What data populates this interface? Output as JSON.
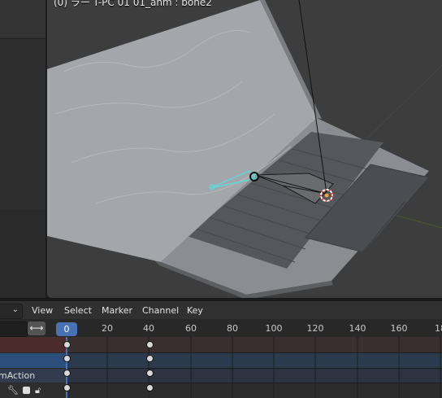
{
  "viewport": {
    "title": "(0) ラー T-PC 01 01_anm : bone2"
  },
  "timeline": {
    "mode_chevron": "⌄",
    "menu": [
      "View",
      "Select",
      "Marker",
      "Channel",
      "Key"
    ],
    "swap_icon": "⟷",
    "current_frame": "0",
    "ticks": [
      "20",
      "40",
      "60",
      "80",
      "100",
      "120",
      "140",
      "160",
      "18"
    ],
    "action_name": "mAction",
    "channel_icons": [
      "wrench-icon",
      "checkbox-icon",
      "lock-icon"
    ],
    "keyframe_frames": [
      0,
      40
    ]
  },
  "colors": {
    "accent": "#4772b3",
    "bone_selected": "#5fd6d6",
    "summary_row": "#4b2b2b",
    "object_row": "#2c4f7c"
  }
}
